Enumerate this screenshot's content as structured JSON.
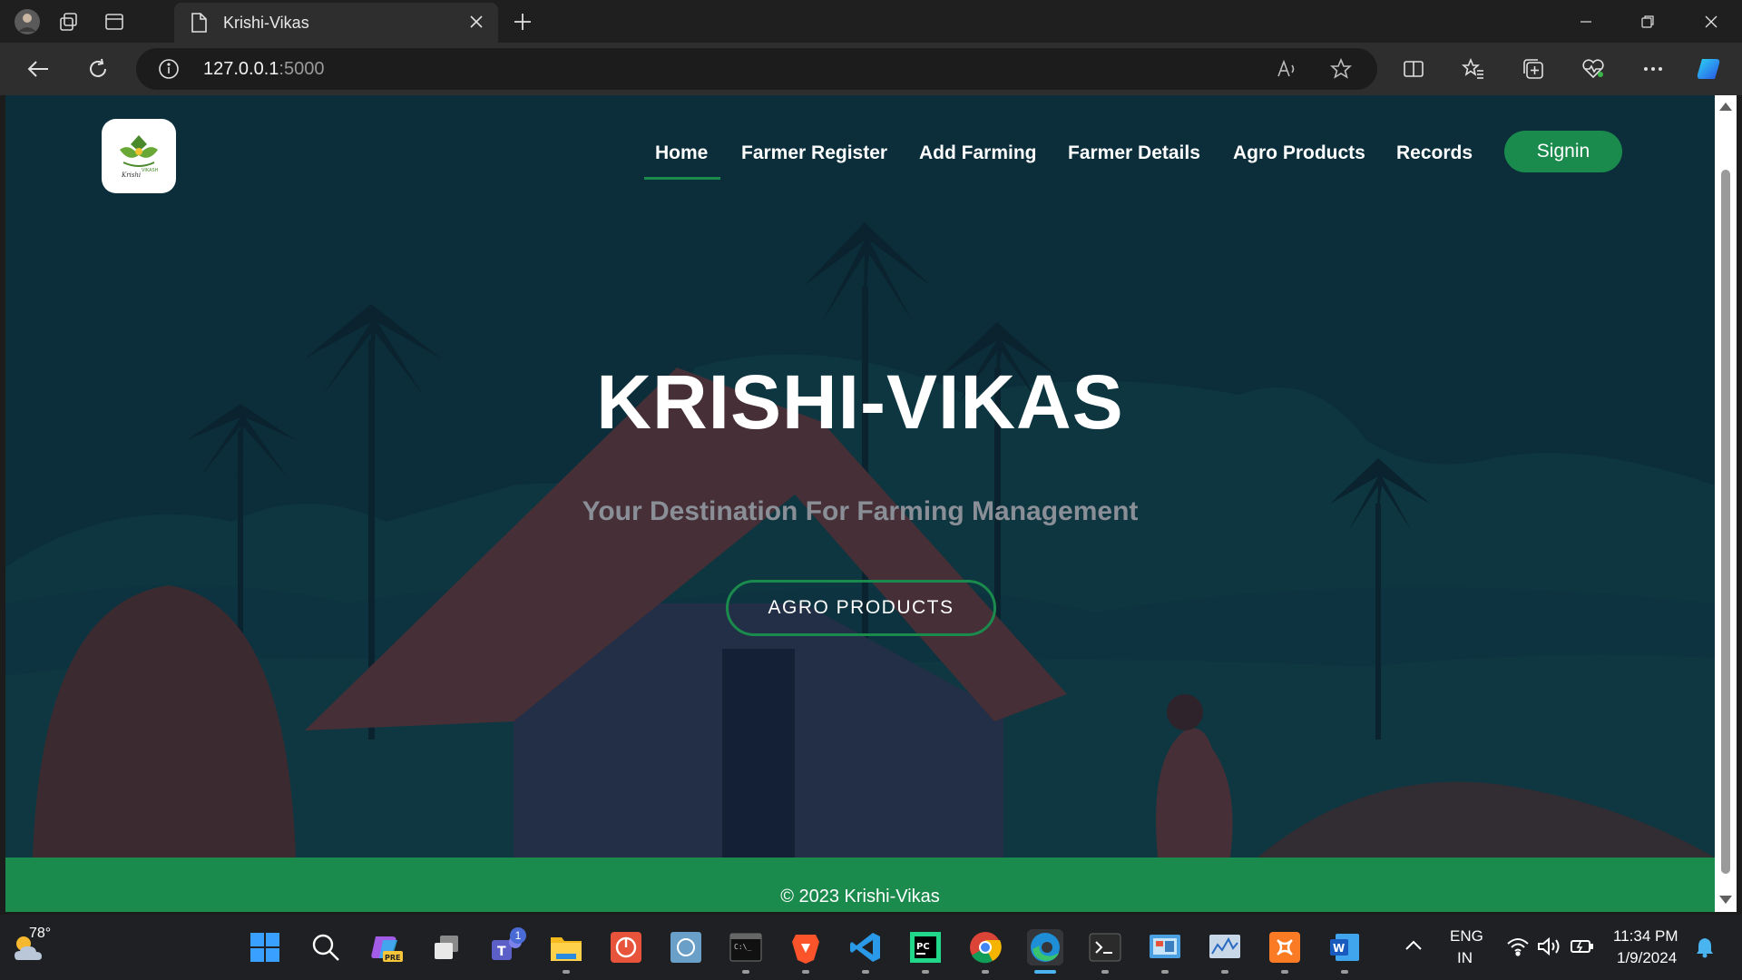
{
  "browser": {
    "tab_title": "Krishi-Vikas",
    "url_host": "127.0.0.1",
    "url_port": ":5000"
  },
  "site": {
    "logo_alt": "Krishi Vikash logo",
    "nav": [
      {
        "label": "Home",
        "active": true
      },
      {
        "label": "Farmer Register"
      },
      {
        "label": "Add Farming"
      },
      {
        "label": "Farmer Details"
      },
      {
        "label": "Agro Products"
      },
      {
        "label": "Records"
      }
    ],
    "signin_label": "Signin",
    "hero_title": "KRISHI-VIKAS",
    "hero_subtitle": "Your Destination For Farming Management",
    "hero_button": "AGRO PRODUCTS",
    "footer_text": "© 2023 Krishi-Vikas",
    "accent_color": "#1b8a4d",
    "background_color": "#0b2e3a"
  },
  "taskbar": {
    "weather_temp": "78°",
    "teams_badge": "1",
    "language_line1": "ENG",
    "language_line2": "IN",
    "time": "11:34 PM",
    "date": "1/9/2024",
    "apps": [
      "windows-start",
      "search",
      "copilot",
      "task-view",
      "teams",
      "file-explorer",
      "power-app",
      "remote-desktop",
      "terminal-cmd",
      "brave",
      "vscode",
      "pycharm",
      "chrome",
      "edge",
      "terminal",
      "control-panel",
      "resource-monitor",
      "xampp",
      "word"
    ]
  }
}
